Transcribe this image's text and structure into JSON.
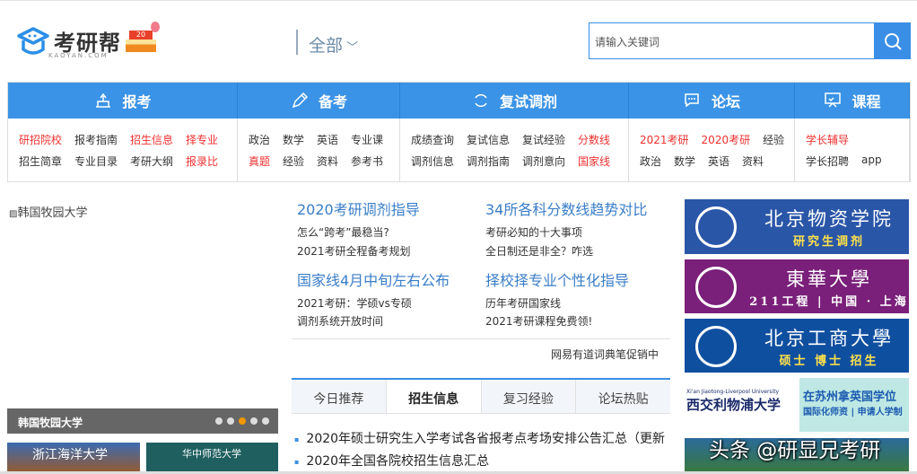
{
  "header": {
    "logo_text": "考研帮",
    "logo_sub": "KAOYAN.COM",
    "cake_number": "20",
    "scope": "全部",
    "search_placeholder": "请输入关键词"
  },
  "nav": [
    {
      "title": "报考",
      "icon": "building-icon",
      "rows": [
        [
          {
            "t": "研招院校",
            "red": true
          },
          {
            "t": "报考指南"
          },
          {
            "t": "招生信息",
            "red": true
          },
          {
            "t": "择专业",
            "red": true
          }
        ],
        [
          {
            "t": "招生简章"
          },
          {
            "t": "专业目录"
          },
          {
            "t": "考研大纲"
          },
          {
            "t": "报录比",
            "red": true
          }
        ]
      ]
    },
    {
      "title": "备考",
      "icon": "pencil-icon",
      "rows": [
        [
          {
            "t": "政治"
          },
          {
            "t": "数学"
          },
          {
            "t": "英语"
          },
          {
            "t": "专业课"
          }
        ],
        [
          {
            "t": "真题",
            "red": true
          },
          {
            "t": "经验"
          },
          {
            "t": "资料"
          },
          {
            "t": "参考书"
          }
        ]
      ]
    },
    {
      "title": "复试调剂",
      "icon": "refresh-icon",
      "rows": [
        [
          {
            "t": "成绩查询"
          },
          {
            "t": "复试信息"
          },
          {
            "t": "复试经验"
          },
          {
            "t": "分数线",
            "red": true
          }
        ],
        [
          {
            "t": "调剂信息"
          },
          {
            "t": "调剂指南"
          },
          {
            "t": "调剂意向"
          },
          {
            "t": "国家线",
            "red": true
          }
        ]
      ]
    },
    {
      "title": "论坛",
      "icon": "chat-icon",
      "rows": [
        [
          {
            "t": "2021考研",
            "red": true
          },
          {
            "t": "2020考研",
            "red": true
          },
          {
            "t": "经验"
          }
        ],
        [
          {
            "t": "政治"
          },
          {
            "t": "数学"
          },
          {
            "t": "英语"
          },
          {
            "t": "资料"
          }
        ]
      ]
    },
    {
      "title": "课程",
      "icon": "presentation-icon",
      "rows": [
        [
          {
            "t": "学长辅导",
            "red": true
          }
        ],
        [
          {
            "t": "学长招聘"
          },
          {
            "t": "app"
          }
        ]
      ]
    }
  ],
  "slider": {
    "alt": "韩国牧园大学",
    "caption": "韩国牧园大学",
    "active_dot": 3,
    "dot_count": 5
  },
  "thumbs": [
    "浙江海洋大学",
    "华中师范大学"
  ],
  "news": {
    "h1": "2020考研调剂指导",
    "l1": [
      "怎么“跨考”最稳当?",
      "2021考研全程备考规划"
    ],
    "h2": "34所各科分数线趋势对比",
    "l2": [
      "考研必知的十大事项",
      "全日制还是非全？咋选"
    ],
    "h3": "国家线4月中旬左右公布",
    "l3": [
      "2021考研：学硕vs专硕",
      "调剂系统开放时间"
    ],
    "h4": "择校择专业个性化指导",
    "l4": [
      "历年考研国家线",
      "2021考研课程免费领!"
    ],
    "promo": "网易有道词典笔促销中"
  },
  "tabs": [
    "今日推荐",
    "招生信息",
    "复习经验",
    "论坛热贴"
  ],
  "active_tab": 1,
  "list": [
    "2020年硕士研究生入学考试各省报考点考场安排公告汇总（更新",
    "2020年全国各院校招生信息汇总"
  ],
  "banners": [
    {
      "big": "北京物资学院",
      "sm": "研究生调剂",
      "bg": "#2a56a8"
    },
    {
      "big": "東華大學",
      "sm": "211工程 | 中国 · 上海",
      "bg": "#7a1f7a"
    },
    {
      "big": "北京工商大學",
      "sm": "硕士 博士 招生",
      "bg": "#0f4fa0"
    },
    {
      "name_en": "Xi'an Jiaotong-Liverpool University",
      "name": "西交利物浦大学",
      "t1": "在苏州拿英国学位",
      "t2": "国际化师资 | 申请人学制"
    }
  ],
  "watermark": "头条 @研显兄考研"
}
